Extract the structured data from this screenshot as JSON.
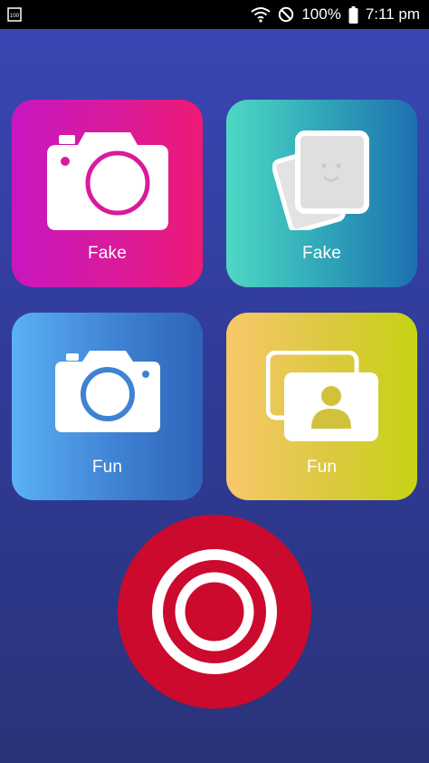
{
  "status_bar": {
    "battery_badge": "100",
    "battery_percent": "100%",
    "time": "7:11 pm",
    "icons": [
      "notification-battery-icon",
      "wifi-icon",
      "do-not-disturb-icon",
      "battery-icon"
    ]
  },
  "tiles": [
    {
      "label": "Fake",
      "icon": "camera-icon"
    },
    {
      "label": "Fake",
      "icon": "photo-stack-icon"
    },
    {
      "label": "Fun",
      "icon": "camera-icon"
    },
    {
      "label": "Fun",
      "icon": "portrait-cards-icon"
    }
  ],
  "record_button": {
    "icon": "record-icon"
  },
  "colors": {
    "background_top": "#3a47b6",
    "background_bottom": "#2a3379",
    "record_red": "#cc0a2e",
    "tile1_gradient": [
      "#c717c0",
      "#ee1a73"
    ],
    "tile2_gradient": [
      "#4ed8c4",
      "#1e6fb1"
    ],
    "tile3_gradient": [
      "#5bb0f5",
      "#2d63b8"
    ],
    "tile4_gradient": [
      "#f7c86a",
      "#c5d314"
    ]
  }
}
